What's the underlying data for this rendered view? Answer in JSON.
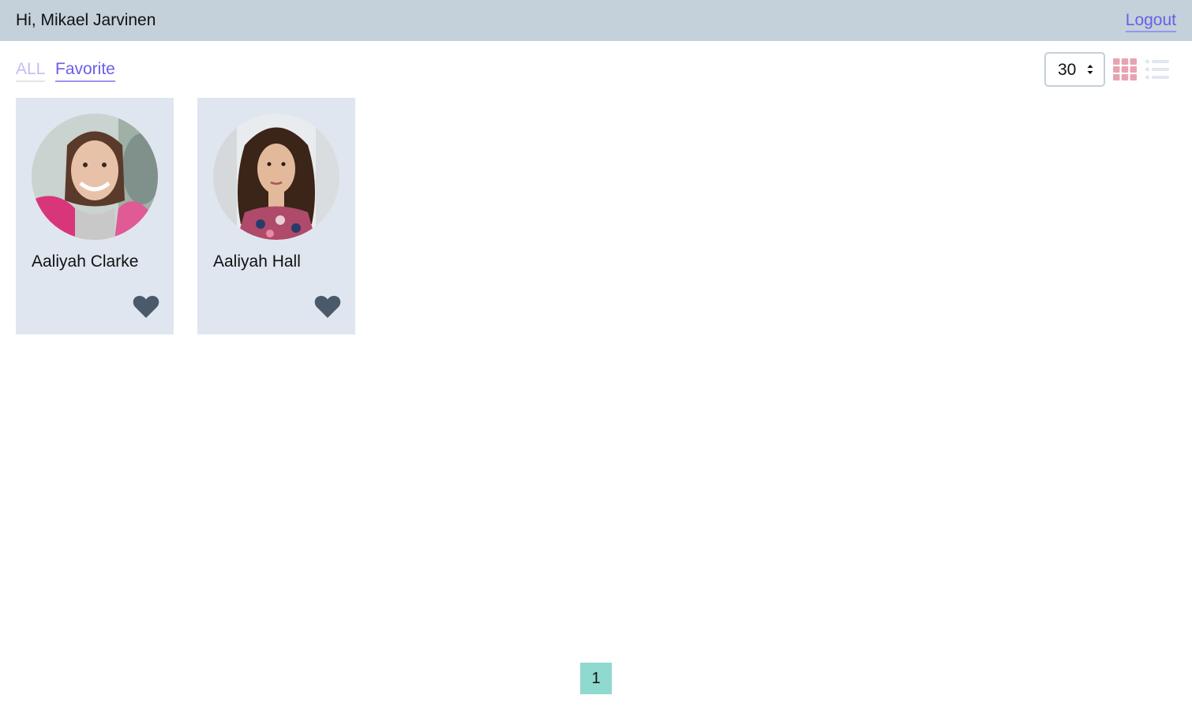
{
  "header": {
    "greeting": "Hi, Mikael Jarvinen",
    "logout_label": "Logout"
  },
  "filters": {
    "tabs": [
      {
        "label": "ALL",
        "active": false
      },
      {
        "label": "Favorite",
        "active": true
      }
    ]
  },
  "page_size": {
    "value": "30"
  },
  "view_toggle": {
    "grid_icon": "grid-view-icon",
    "list_icon": "list-view-icon",
    "active": "grid"
  },
  "users": [
    {
      "name": "Aaliyah Clarke",
      "favorite": true
    },
    {
      "name": "Aaliyah Hall",
      "favorite": true
    }
  ],
  "pagination": {
    "pages": [
      "1"
    ],
    "current": "1"
  },
  "colors": {
    "header_bg": "#c4d0da",
    "accent": "#6a5ee8",
    "card_bg": "#e0e6ef",
    "heart": "#4a5a6a",
    "grid_icon": "#e8a3b3",
    "list_icon": "#e2e6f0",
    "page_active": "#8fd9cf"
  }
}
